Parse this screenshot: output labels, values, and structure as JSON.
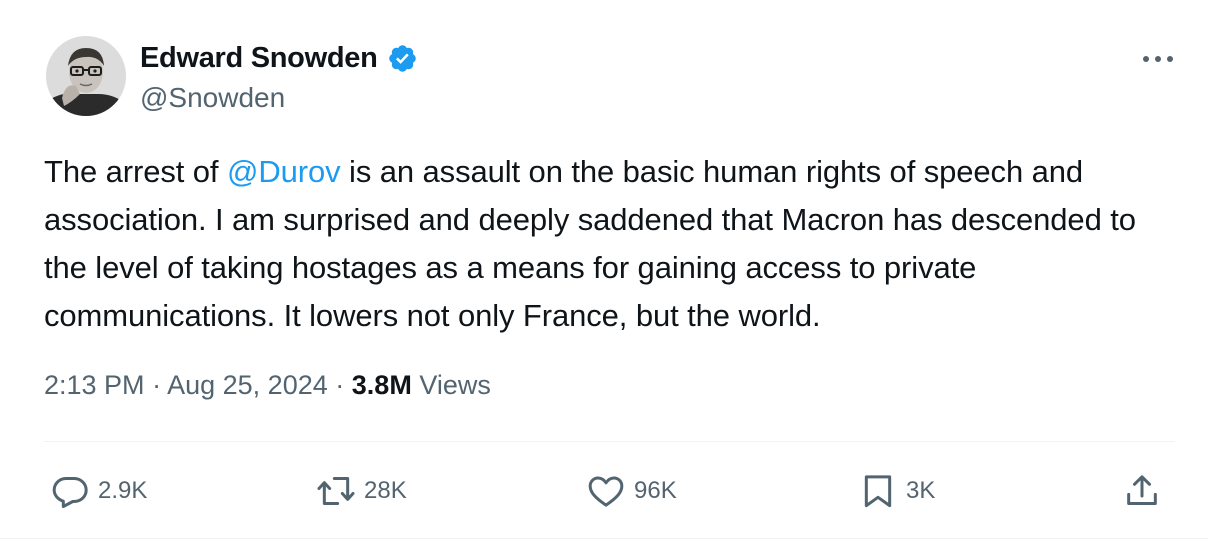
{
  "author": {
    "display_name": "Edward Snowden",
    "handle": "@Snowden",
    "verified": true,
    "avatar": "profile-photo"
  },
  "tweet": {
    "text_before": "The arrest of ",
    "mention": "@Durov",
    "text_after": " is an assault on the basic human rights of speech and association. I am surprised and deeply saddened that Macron has descended to the level of taking hostages as a means for gaining access to private communications. It lowers not only France, but the world."
  },
  "meta": {
    "time": "2:13 PM",
    "separator": "·",
    "date": "Aug 25, 2024",
    "views_count": "3.8M",
    "views_label": "Views"
  },
  "actions": {
    "replies": "2.9K",
    "reposts": "28K",
    "likes": "96K",
    "bookmarks": "3K"
  },
  "icons": {
    "more": "more-dots-icon",
    "verified": "verified-badge-icon",
    "reply": "reply-icon",
    "repost": "repost-icon",
    "like": "heart-icon",
    "bookmark": "bookmark-icon",
    "share": "share-icon"
  },
  "colors": {
    "text": "#0f1419",
    "secondary": "#536471",
    "accent": "#1d9bf0",
    "divider": "#eff3f4"
  }
}
